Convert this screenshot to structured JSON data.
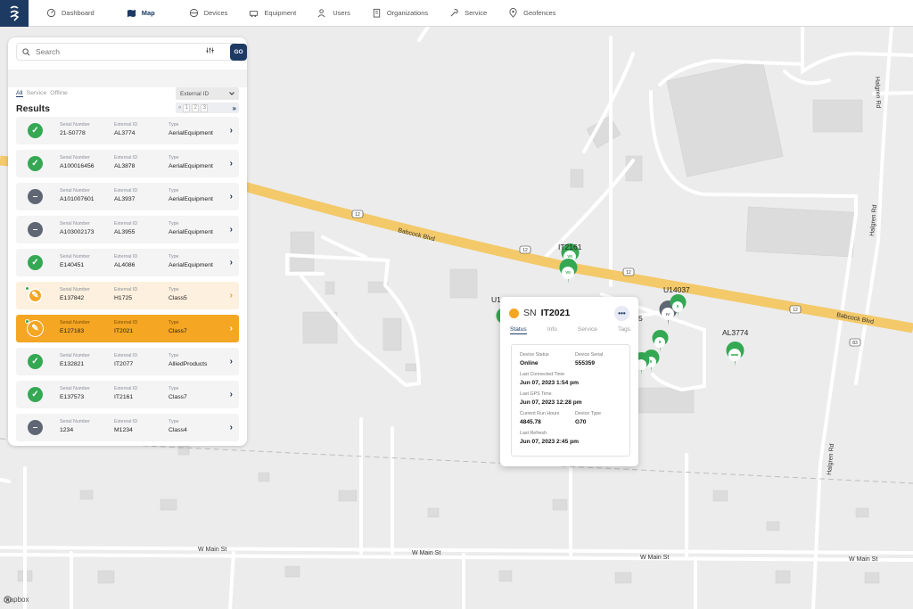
{
  "nav": {
    "items": [
      {
        "label": "Dashboard",
        "icon": "dashboard-icon"
      },
      {
        "label": "Map",
        "icon": "map-icon"
      },
      {
        "label": "Devices",
        "icon": "devices-icon"
      },
      {
        "label": "Equipment",
        "icon": "equipment-icon"
      },
      {
        "label": "Users",
        "icon": "users-icon"
      },
      {
        "label": "Organizations",
        "icon": "organizations-icon"
      },
      {
        "label": "Service",
        "icon": "service-icon"
      },
      {
        "label": "Geofences",
        "icon": "geofences-icon"
      }
    ],
    "active": "Map"
  },
  "search": {
    "placeholder": "Search",
    "go_label": "GO"
  },
  "filters": {
    "tabs": [
      "All",
      "Service",
      "Offline"
    ],
    "active": "All",
    "sort_select": "External ID"
  },
  "results": {
    "title": "Results",
    "pages": [
      "1",
      "2",
      "3"
    ],
    "columns": {
      "serial": "Serial Number",
      "external": "External ID",
      "type": "Type"
    },
    "rows": [
      {
        "status": "online",
        "serial": "21-50778",
        "external": "AL3774",
        "type": "AerialEquipment"
      },
      {
        "status": "online",
        "serial": "A100016456",
        "external": "AL3878",
        "type": "AerialEquipment"
      },
      {
        "status": "offline",
        "serial": "A101007601",
        "external": "AL3937",
        "type": "AerialEquipment"
      },
      {
        "status": "offline",
        "serial": "A103002173",
        "external": "AL3955",
        "type": "AerialEquipment"
      },
      {
        "status": "online",
        "serial": "E140451",
        "external": "AL4086",
        "type": "AerialEquipment"
      },
      {
        "status": "maintenance",
        "serial": "E137842",
        "external": "H1725",
        "type": "Class5"
      },
      {
        "status": "maintenance",
        "serial": "E127183",
        "external": "IT2021",
        "type": "Class7",
        "selected": true
      },
      {
        "status": "online",
        "serial": "E132821",
        "external": "IT2077",
        "type": "AlliedProducts"
      },
      {
        "status": "online",
        "serial": "E137573",
        "external": "IT2161",
        "type": "Class7"
      },
      {
        "status": "offline",
        "serial": "1234",
        "external": "M1234",
        "type": "Class4"
      }
    ]
  },
  "map": {
    "streets": [
      "Babcock Blvd",
      "Babcock Blvd",
      "Halgren Rd",
      "Halgren Rd",
      "Halgren Rd",
      "W Main St",
      "W Main St",
      "W Main St",
      "W Main St"
    ],
    "route_shields": [
      "12",
      "12",
      "12",
      "12",
      "12",
      "83"
    ],
    "pin_labels": [
      "IT2161",
      "U14037",
      "AL3774",
      "U1",
      "5"
    ],
    "attribution": "mapbox"
  },
  "popup": {
    "sn_prefix": "SN",
    "device_id": "IT2021",
    "more_label": "•••",
    "tabs": [
      "Status",
      "Info",
      "Service",
      "Tags"
    ],
    "fields": {
      "device_status_label": "Device Status",
      "device_status": "Online",
      "device_serial_label": "Device Serial",
      "device_serial": "555359",
      "last_connected_label": "Last Connected Time",
      "last_connected": "Jun 07, 2023 1:54 pm",
      "last_gps_label": "Last GPS Time",
      "last_gps": "Jun 07, 2023 12:28 pm",
      "run_hours_label": "Current Run Hours",
      "run_hours": "4845.78",
      "device_type_label": "Device Type",
      "device_type": "G70",
      "last_refresh_label": "Last Refresh",
      "last_refresh": "Jun 07, 2023 2:45 pm"
    }
  },
  "colors": {
    "brand": "#1d3a63",
    "accent": "#4aa7e0",
    "online": "#34a853",
    "offline": "#606774",
    "maintenance": "#f5a623",
    "road": "#f3c969"
  }
}
